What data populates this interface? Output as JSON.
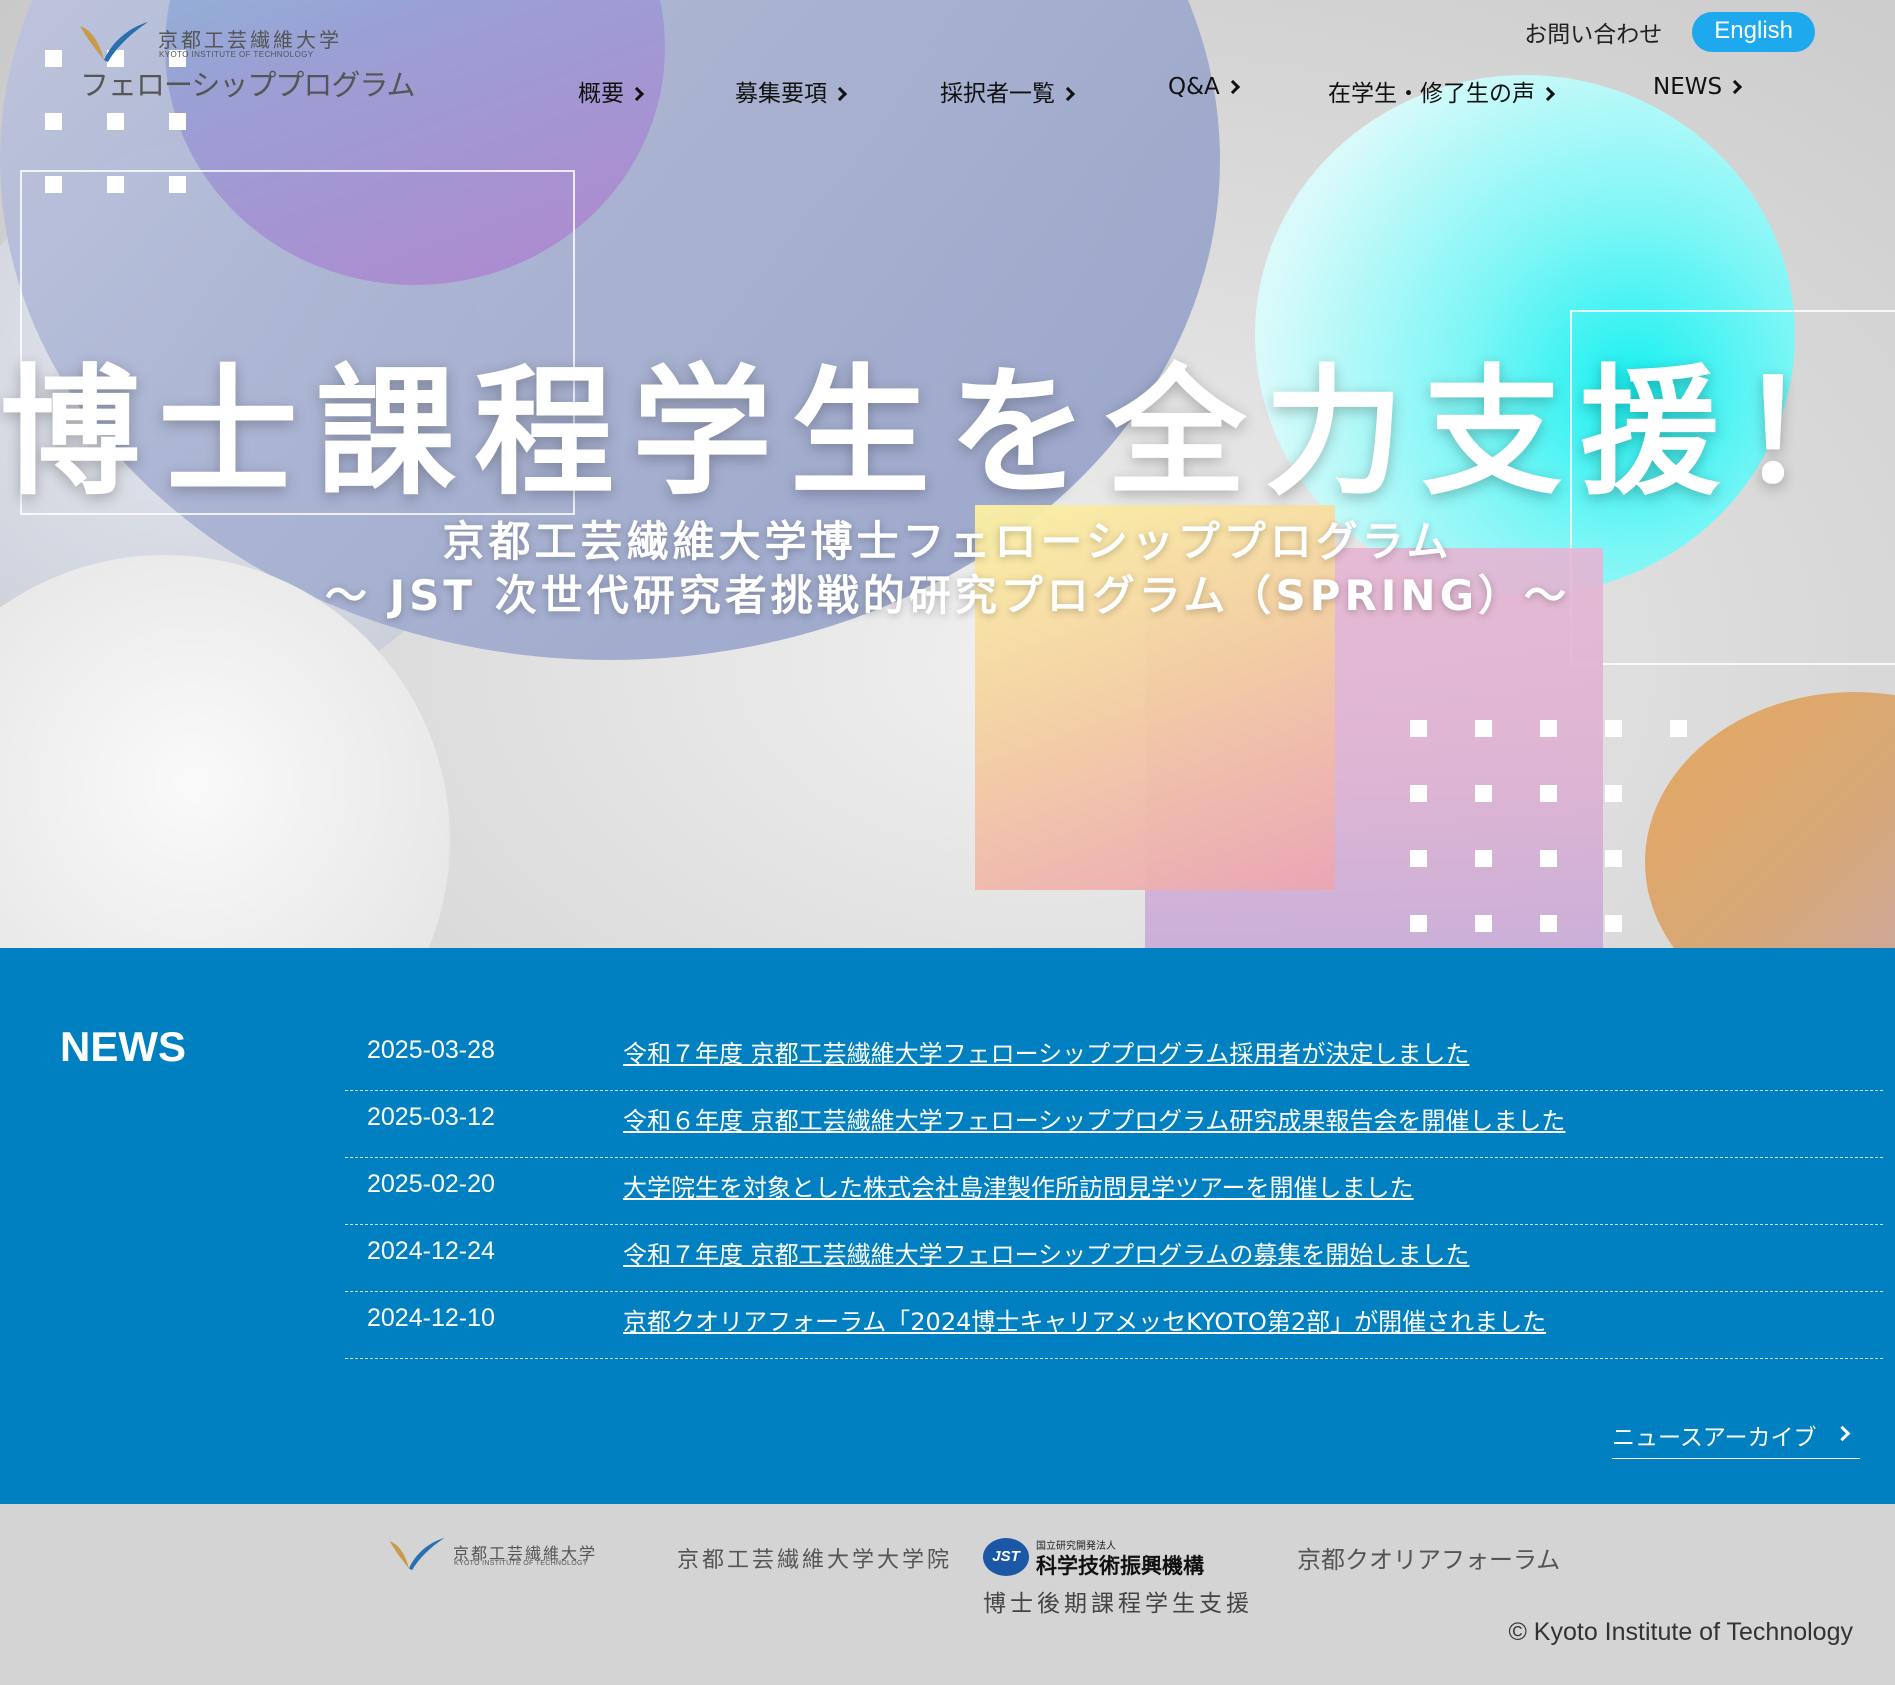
{
  "header": {
    "logo": {
      "university_name": "京都工芸繊維大学",
      "university_name_en": "KYOTO INSTITUTE OF TECHNOLOGY",
      "program_name": "フェローシッププログラム"
    },
    "contact_label": "お問い合わせ",
    "language_label": "English",
    "nav": [
      {
        "label": "概要"
      },
      {
        "label": "募集要項"
      },
      {
        "label": "採択者一覧"
      },
      {
        "label": "Q&A"
      },
      {
        "label": "在学生・修了生の声"
      },
      {
        "label": "NEWS"
      }
    ]
  },
  "hero": {
    "title": "博士課程学生を全力支援！",
    "subtitle_line1": "京都工芸繊維大学博士フェローシッププログラム",
    "subtitle_line2": "～ JST 次世代研究者挑戦的研究プログラム（SPRING）～"
  },
  "news": {
    "heading": "NEWS",
    "items": [
      {
        "date": "2025-03-28",
        "title": "令和７年度 京都工芸繊維大学フェローシッププログラム採用者が決定しました"
      },
      {
        "date": "2025-03-12",
        "title": "令和６年度 京都工芸繊維大学フェローシッププログラム研究成果報告会を開催しました"
      },
      {
        "date": "2025-02-20",
        "title": "大学院生を対象とした株式会社島津製作所訪問見学ツアーを開催しました"
      },
      {
        "date": "2024-12-24",
        "title": "令和７年度 京都工芸繊維大学フェローシッププログラムの募集を開始しました"
      },
      {
        "date": "2024-12-10",
        "title": "京都クオリアフォーラム「2024博士キャリアメッセKYOTO第2部」が開催されました"
      }
    ],
    "archive_label": "ニュースアーカイブ"
  },
  "footer": {
    "logos": {
      "kit_name": "京都工芸繊維大学",
      "kit_name_en": "KYOTO INSTITUTE OF TECHNOLOGY",
      "graduate_school": "京都工芸繊維大学大学院",
      "jst_badge": "JST",
      "jst_small": "国立研究開発法人",
      "jst_org": "科学技術振興機構",
      "jst_sub": "博士後期課程学生支援",
      "qualia": "京都クオリアフォーラム"
    },
    "copyright": "© Kyoto Institute of Technology"
  },
  "colors": {
    "news_background": "#0080c0",
    "language_button": "#1ea8ee",
    "page_background": "#d4d4d4",
    "logo_mark_gold": "#c99a4a",
    "logo_mark_blue": "#2a6fb0"
  }
}
